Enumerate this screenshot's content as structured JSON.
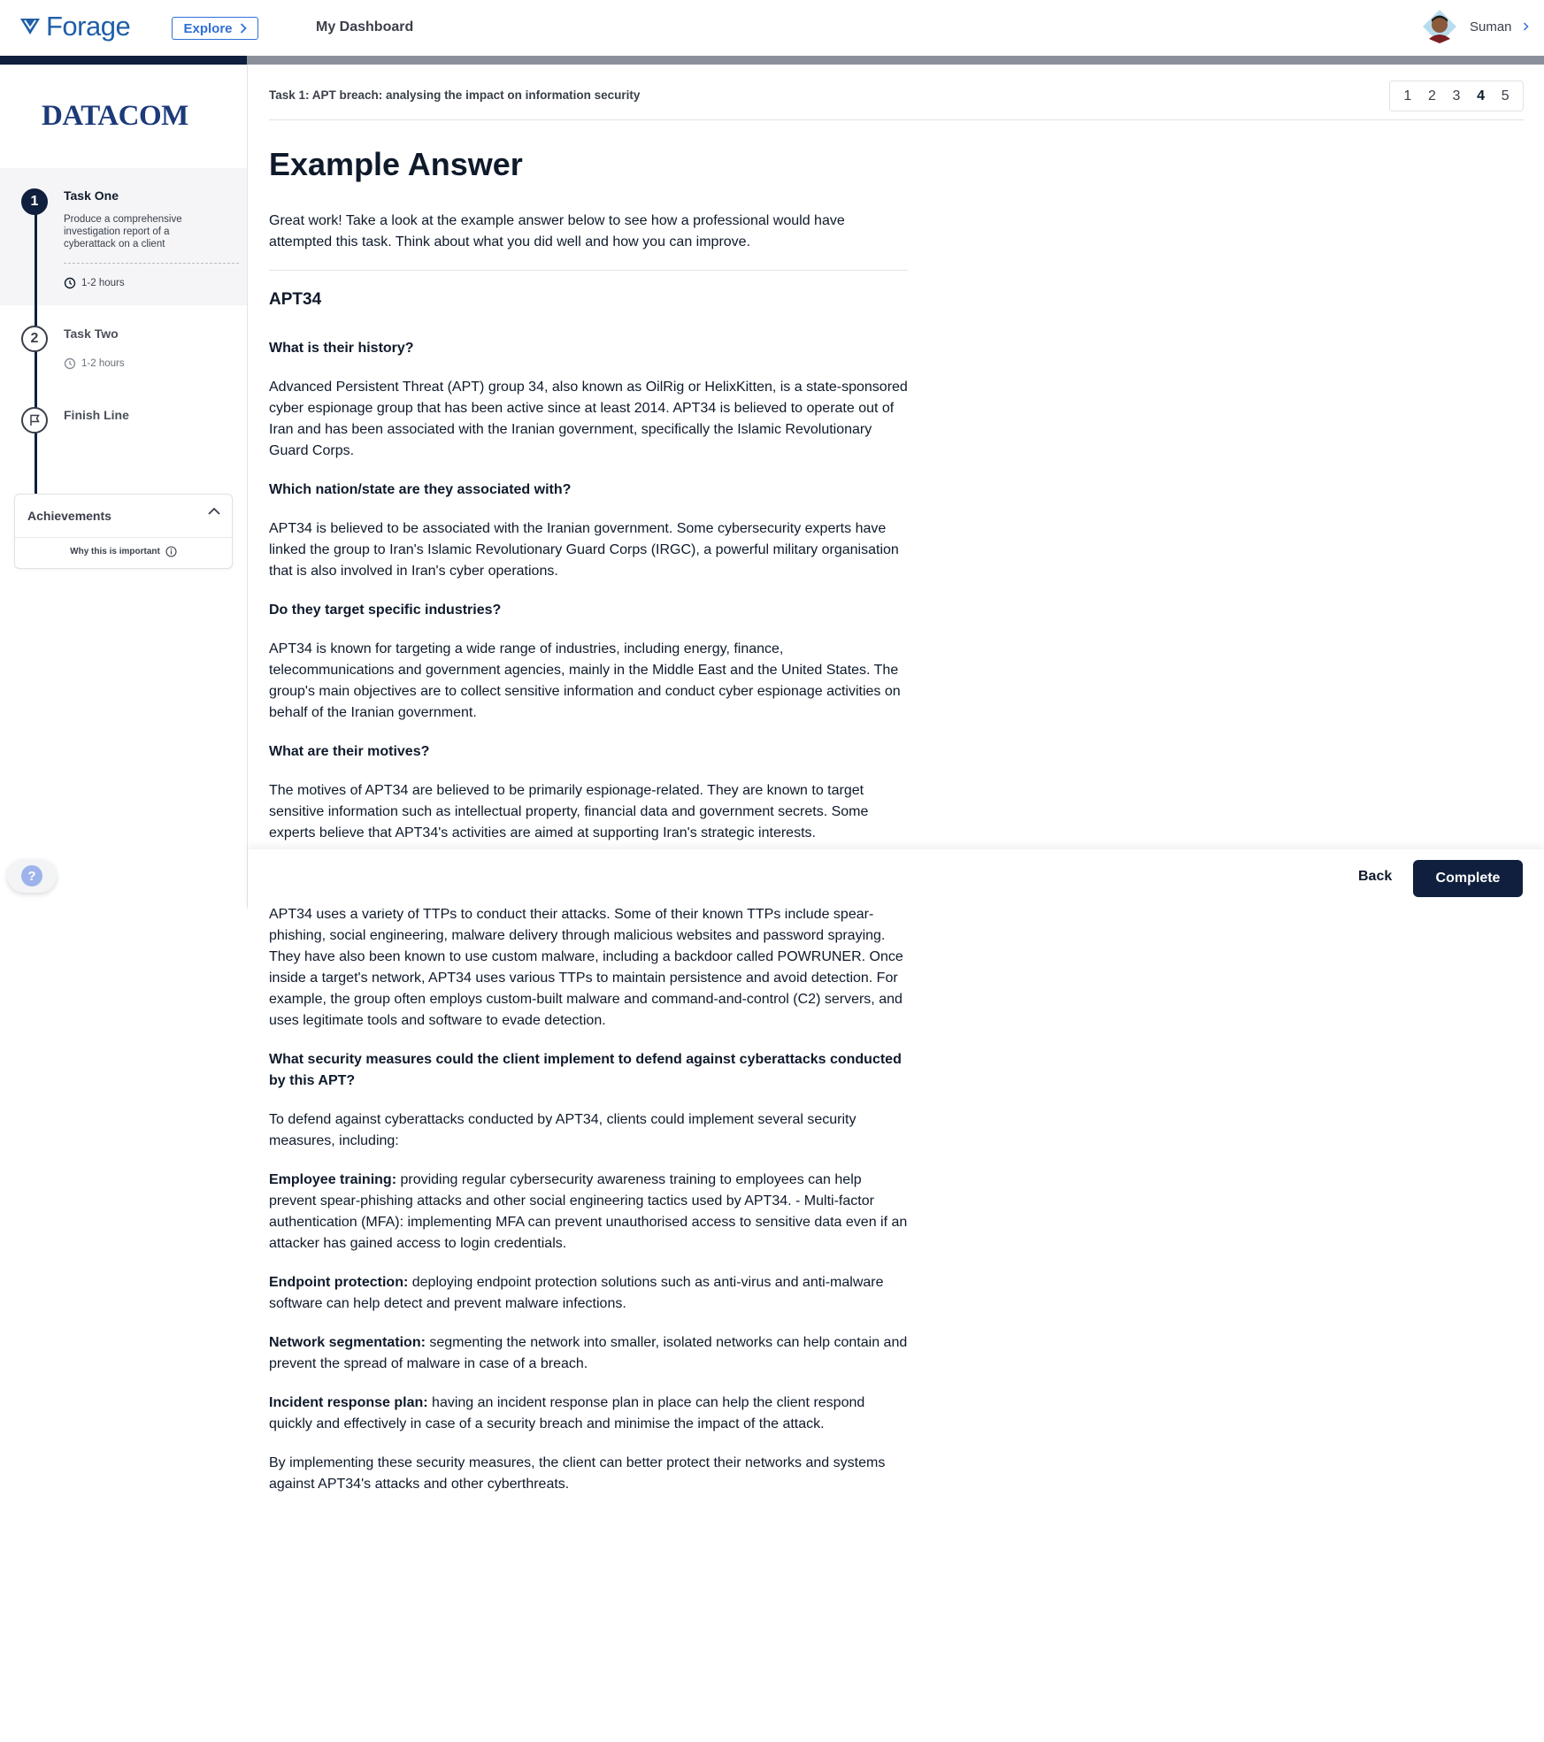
{
  "nav": {
    "logo_text": "Forage",
    "explore_label": "Explore",
    "dashboard_label": "My Dashboard",
    "user_name": "Suman",
    "progress_fraction": 0.16
  },
  "sidebar": {
    "brand": "DATACOM",
    "steps": [
      {
        "number": "1",
        "title": "Task One",
        "description": "Produce a comprehensive investigation report of a cyberattack on a client",
        "duration": "1-2 hours",
        "state": "active"
      },
      {
        "number": "2",
        "title": "Task Two",
        "duration": "1-2 hours",
        "state": "idle"
      },
      {
        "number": "",
        "title": "Finish Line",
        "state": "idle"
      }
    ],
    "achievements": {
      "title": "Achievements",
      "why_label": "Why this is important"
    }
  },
  "main": {
    "breadcrumb": "Task 1: APT breach: analysing the impact on information security",
    "pager": [
      "1",
      "2",
      "3",
      "4",
      "5"
    ],
    "pager_current": "4",
    "title": "Example Answer",
    "intro": "Great work! Take a look at the example answer below to see how a professional would have attempted this task. Think about what you did well and how you can improve.",
    "section_title": "APT34",
    "q1": "What is their history?",
    "a1": "Advanced Persistent Threat (APT) group 34, also known as OilRig or HelixKitten, is a state-sponsored cyber espionage group that has been active since at least 2014. APT34 is believed to operate out of Iran and has been associated with the Iranian government, specifically the Islamic Revolutionary Guard Corps.",
    "q2": "Which nation/state are they associated with?",
    "a2": "APT34 is believed to be associated with the Iranian government. Some cybersecurity experts have linked the group to Iran's Islamic Revolutionary Guard Corps (IRGC), a powerful military organisation that is also involved in Iran's cyber operations.",
    "q3": "Do they target specific industries?",
    "a3": "APT34 is known for targeting a wide range of industries, including energy, finance, telecommunications and government agencies, mainly in the Middle East and the United States. The group's main objectives are to collect sensitive information and conduct cyber espionage activities on behalf of the Iranian government.",
    "q4": "What are their motives?",
    "a4": "The motives of APT34 are believed to be primarily espionage-related. They are known to target sensitive information such as intellectual property, financial data and government secrets. Some experts believe that APT34's activities are aimed at supporting Iran's strategic interests.",
    "a5": "APT34 uses a variety of TTPs to conduct their attacks. Some of their known TTPs include spear-phishing, social engineering, malware delivery through malicious websites and password spraying. They have also been known to use custom malware, including a backdoor called POWRUNER. Once inside a target's network, APT34 uses various TTPs to maintain persistence and avoid detection. For example, the group often employs custom-built malware and command-and-control (C2) servers, and uses legitimate tools and software to evade detection.",
    "q6": "What security measures could the client implement to defend against cyberattacks conducted by this APT?",
    "a6": "To defend against cyberattacks conducted by APT34, clients could implement several security measures, including:",
    "m1_label": "Employee training:",
    "m1_text": " providing regular cybersecurity awareness training to employees can help prevent spear-phishing attacks and other social engineering tactics used by APT34. - Multi-factor authentication (MFA): implementing MFA can prevent unauthorised access to sensitive data even if an attacker has gained access to login credentials.",
    "m2_label": "Endpoint protection:",
    "m2_text": " deploying endpoint protection solutions such as anti-virus and anti-malware software can help detect and prevent malware infections.",
    "m3_label": "Network segmentation:",
    "m3_text": " segmenting the network into smaller, isolated networks can help contain and prevent the spread of malware in case of a breach.",
    "m4_label": "Incident response plan:",
    "m4_text": " having an incident response plan in place can help the client respond quickly and effectively in case of a security breach and minimise the impact of the attack.",
    "closing": "By implementing these security measures, the client can better protect their networks and systems against APT34's attacks and other cyberthreats."
  },
  "actions": {
    "back_label": "Back",
    "complete_label": "Complete"
  },
  "help": {
    "glyph": "?"
  },
  "colors": {
    "navy": "#0f1f3d",
    "brand_blue": "#1f5fa8",
    "link_blue": "#2f6fd6"
  }
}
